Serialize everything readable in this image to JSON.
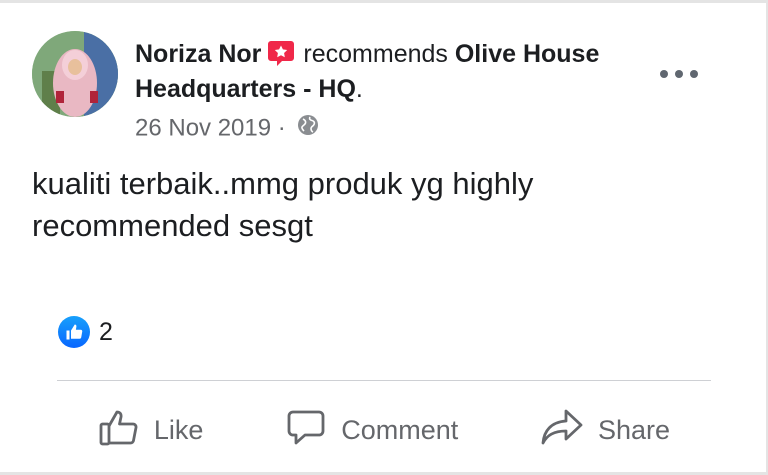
{
  "post": {
    "author_name": "Noriza Nor",
    "action_text": "recommends",
    "page_name": "Olive House Headquarters - HQ",
    "page_suffix": ".",
    "date": "26 Nov 2019",
    "date_separator": " · ",
    "privacy_icon": "globe-icon",
    "recommend_icon": "recommend-badge-icon",
    "text": "kualiti terbaik..mmg produk yg highly recommended sesgt"
  },
  "reactions": {
    "icon": "like-reaction-icon",
    "count": "2"
  },
  "actions": [
    {
      "label": "Like",
      "icon": "thumbs-up-icon"
    },
    {
      "label": "Comment",
      "icon": "comment-icon"
    },
    {
      "label": "Share",
      "icon": "share-icon"
    }
  ],
  "colors": {
    "like_blue": "#0866ff",
    "recommend_red": "#f02849",
    "secondary_text": "#65676b"
  }
}
